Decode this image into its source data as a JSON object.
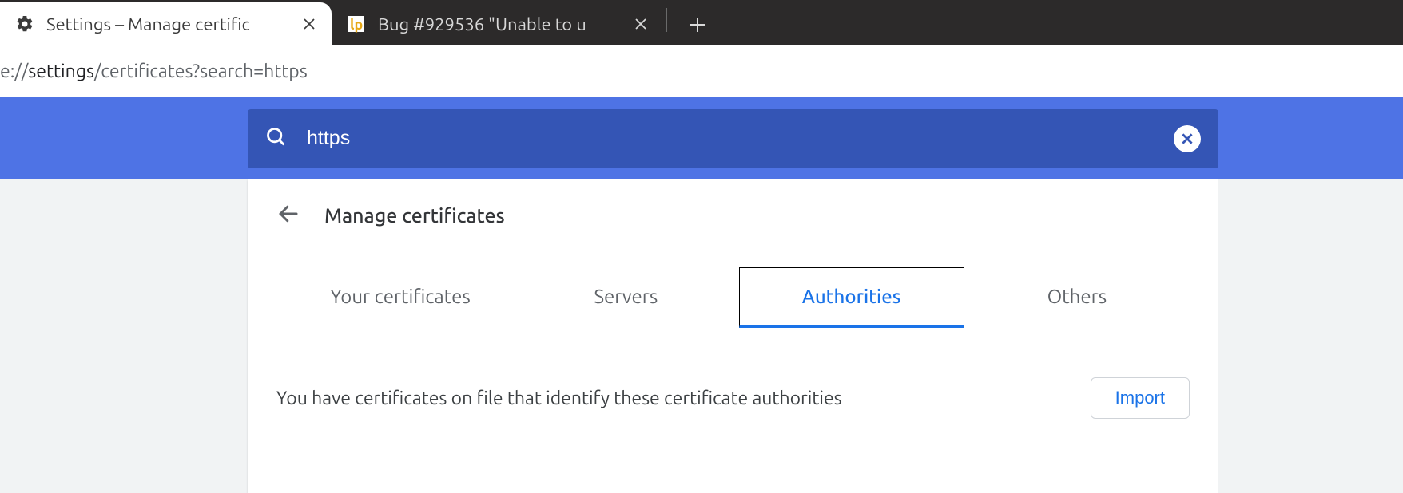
{
  "tabs": {
    "items": [
      {
        "title": "Settings – Manage certific",
        "active": true
      },
      {
        "title": "Bug #929536 \"Unable to u",
        "active": false
      }
    ]
  },
  "url": {
    "prefix": "e://",
    "strong": "settings",
    "rest": "/certificates?search=https"
  },
  "search": {
    "value": "https"
  },
  "panel": {
    "title": "Manage certificates"
  },
  "cert_tabs": {
    "items": [
      {
        "label": "Your certificates"
      },
      {
        "label": "Servers"
      },
      {
        "label": "Authorities"
      },
      {
        "label": "Others"
      }
    ],
    "active_index": 2
  },
  "description": "You have certificates on file that identify these certificate authorities",
  "import_label": "Import"
}
